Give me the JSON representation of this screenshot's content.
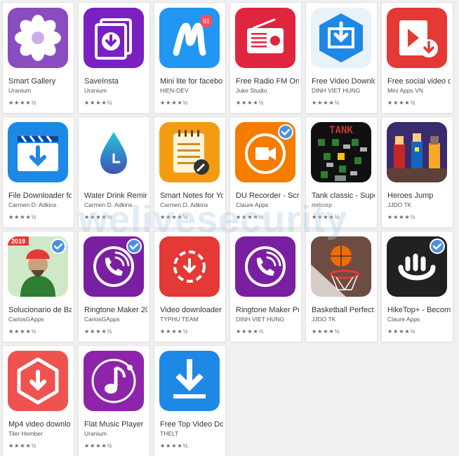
{
  "watermark": "welivesecurity",
  "apps": [
    {
      "title": "Smart Gallery",
      "developer": "Uranium",
      "rating": "★★★★½",
      "icon": "flower-gallery-icon",
      "bg": "#8a4dc0"
    },
    {
      "title": "SaveInsta",
      "developer": "Uranium",
      "rating": "★★★★½",
      "icon": "download-stack-icon",
      "bg": "#7a1fc2"
    },
    {
      "title": "Mini lite for facebo",
      "developer": "HIEN-DEV",
      "rating": "★★★★½",
      "icon": "messenger-m-icon",
      "bg": "#2196f3",
      "badge": "91"
    },
    {
      "title": "Free Radio FM Onli",
      "developer": "Juke Studio",
      "rating": "★★★★½",
      "icon": "radio-icon",
      "bg": "#e0253f"
    },
    {
      "title": "Free Video Downlo",
      "developer": "DINH VIET HUNG",
      "rating": "★★★★½",
      "icon": "video-download-hexagon-icon",
      "bg": "#1e88e5"
    },
    {
      "title": "Free social video d",
      "developer": "Mini Apps VN",
      "rating": "★★★★½",
      "icon": "play-download-icon",
      "bg": "#e53935"
    },
    {
      "title": "File Downloader for",
      "developer": "Carmen D. Adkins",
      "rating": "★★★★½",
      "icon": "clapper-download-icon",
      "bg": "#1e88e5"
    },
    {
      "title": "Water Drink Remin",
      "developer": "Carmen D. Adkins",
      "rating": "★★★★½",
      "icon": "water-drop-clock-icon",
      "bg": "#ffffff"
    },
    {
      "title": "Smart Notes for Yo",
      "developer": "Carmen D. Adkins",
      "rating": "★★★★½",
      "icon": "notepad-icon",
      "bg": "#f39c12"
    },
    {
      "title": "DU Recorder - Scre",
      "developer": "Claure Apps",
      "rating": "★★★★½",
      "icon": "recorder-camera-icon",
      "bg": "#f57c00",
      "verified": true
    },
    {
      "title": "Tank classic - Supe",
      "developer": "mrtcorp",
      "rating": "★★★★½",
      "icon": "tank-game-icon",
      "bg": "#101010"
    },
    {
      "title": "Heroes Jump",
      "developer": "JJDO TK",
      "rating": "★★★★½",
      "icon": "heroes-pixel-icon",
      "bg": "#3a2a6e"
    },
    {
      "title": "Solucionario de Ba",
      "developer": "CarlosGApps",
      "rating": "★★★★½",
      "icon": "portrait-book-icon",
      "bg": "#2e7d32",
      "verified": true,
      "label": "2019"
    },
    {
      "title": "Ringtone Maker 20",
      "developer": "CarlosGApps",
      "rating": "★★★★½",
      "icon": "ringtone-phone-icon",
      "bg": "#7b1fa2",
      "verified": true
    },
    {
      "title": "Video downloader",
      "developer": "TYPHU TEAM",
      "rating": "★★★★½",
      "icon": "circle-download-icon",
      "bg": "#e53935"
    },
    {
      "title": "Ringtone Maker Pro",
      "developer": "DINH VIET HUNG",
      "rating": "★★★★½",
      "icon": "ringtone-phone-icon",
      "bg": "#7b1fa2"
    },
    {
      "title": "Basketball Perfect",
      "developer": "JJDO TK",
      "rating": "★★★★½",
      "icon": "basketball-hoop-icon",
      "bg": "#6d4c41"
    },
    {
      "title": "HikeTop+ - Become",
      "developer": "Claure Apps",
      "rating": "★★★★½",
      "icon": "hiketop-icon",
      "bg": "#212121",
      "verified": true
    },
    {
      "title": "Mp4 video downlo",
      "developer": "Tiler Hember",
      "rating": "★★★★½",
      "icon": "shield-download-icon",
      "bg": "#ef5350"
    },
    {
      "title": "Flat Music Player",
      "developer": "Uranium",
      "rating": "★★★★½",
      "icon": "music-note-icon",
      "bg": "#8e24aa"
    },
    {
      "title": "Free Top Video Dow",
      "developer": "THELT",
      "rating": "★★★★½",
      "icon": "arrow-download-icon",
      "bg": "#1e88e5"
    }
  ]
}
